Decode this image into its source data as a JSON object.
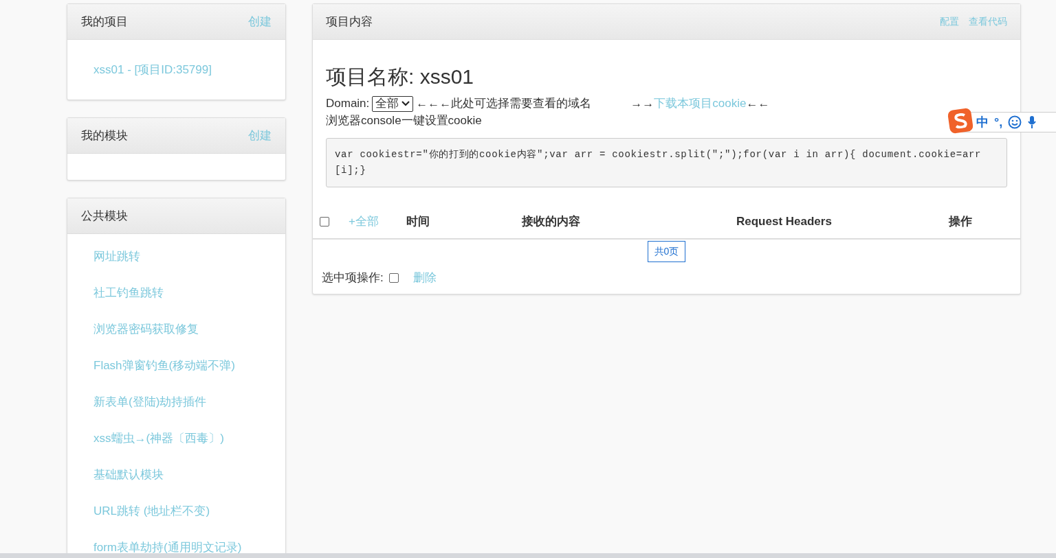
{
  "my_projects": {
    "title": "我的项目",
    "action": "创建",
    "items": [
      "xss01 - [项目ID:35799]"
    ]
  },
  "my_modules": {
    "title": "我的模块",
    "action": "创建"
  },
  "public_modules": {
    "title": "公共模块",
    "items": [
      "网址跳转",
      "社工钓鱼跳转",
      "浏览器密码获取修复",
      "Flash弹窗钓鱼(移动端不弹)",
      "新表单(登陆)劫持插件",
      "xss蠕虫→(神器〔西毒〕)",
      "基础默认模块",
      "URL跳转 (地址栏不变)",
      "form表单劫持(通用明文记录)"
    ]
  },
  "content": {
    "title": "项目内容",
    "actions": [
      "配置",
      "查看代码"
    ],
    "project_name": "项目名称: xss01",
    "domain_label": "Domain:",
    "domain_select": "全部",
    "domain_hint": "←←←此处可选择需要查看的域名",
    "download_prefix": "→→",
    "download_link": "下载本项目cookie",
    "download_suffix": "←←",
    "console_hint": "浏览器console一键设置cookie",
    "code": "var cookiestr=\"你的打到的cookie内容\";var arr = cookiestr.split(\";\");for(var i in arr){ document.cookie=arr[i];}",
    "table": {
      "select_all_checked": false,
      "all_link": "+全部",
      "columns": [
        "时间",
        "接收的内容",
        "Request Headers",
        "操作"
      ]
    },
    "pagination": "共0页",
    "bulk": {
      "label": "选中项操作:",
      "checked": false,
      "delete": "删除"
    }
  },
  "ime_toolbar": {
    "items": [
      "中",
      "°,"
    ]
  }
}
